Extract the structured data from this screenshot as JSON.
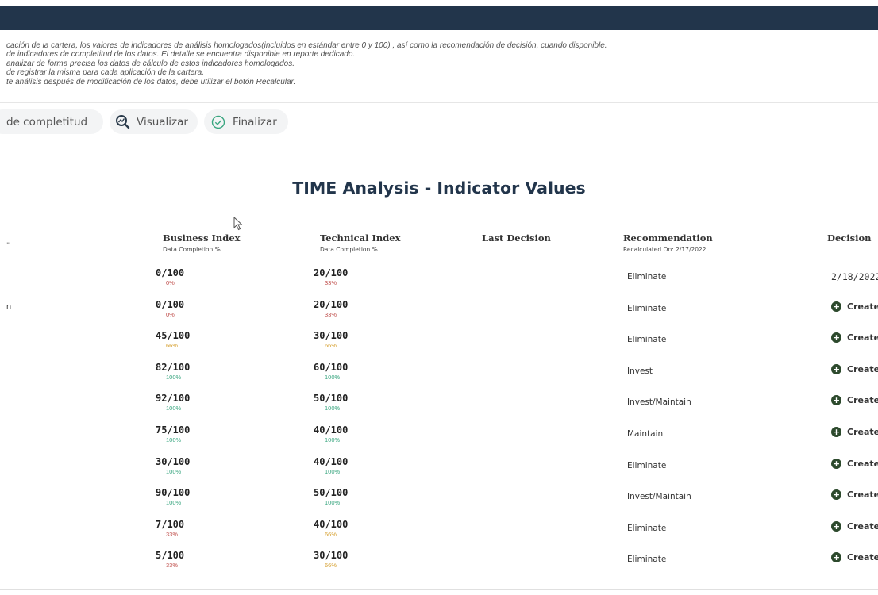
{
  "info_lines": [
    "cación de la cartera, los valores de indicadores de análisis homologados(incluidos en estándar entre 0 y 100) , así como la recomendación de decisión, cuando disponible.",
    "de indicadores de completitud de los datos. El detalle se encuentra disponible en reporte dedicado.",
    "analizar de forma precisa los datos de cálculo de estos indicadores homologados.",
    "de registrar la misma para cada aplicación de la cartera.",
    "te análisis después de modificación de los datos, debe utilizar el botón Recalcular."
  ],
  "toolbar": {
    "completeness_label": "de completitud",
    "visualize_label": "Visualizar",
    "finalize_label": "Finalizar"
  },
  "title": "TIME Analysis - Indicator Values",
  "edge_marks": {
    "header": "\"",
    "row2": "n"
  },
  "columns": {
    "business": {
      "label": "Business Index",
      "sub": "Data Completion %"
    },
    "technical": {
      "label": "Technical Index",
      "sub": "Data Completion %"
    },
    "last_decision": {
      "label": "Last Decision"
    },
    "recommendation": {
      "label": "Recommendation",
      "sub": "Recalculated On: 2/17/2022"
    },
    "decision": {
      "label": "Decision"
    }
  },
  "colors": {
    "low": "#c0504d",
    "mid": "#d6a030",
    "high": "#3aa680"
  },
  "rows": [
    {
      "business": "0/100",
      "business_pct": "0%",
      "business_level": "low",
      "technical": "20/100",
      "technical_pct": "33%",
      "technical_level": "low",
      "recommendation": "Eliminate",
      "decision": "2/18/2022",
      "decision_type": "date"
    },
    {
      "business": "0/100",
      "business_pct": "0%",
      "business_level": "low",
      "technical": "20/100",
      "technical_pct": "33%",
      "technical_level": "low",
      "recommendation": "Eliminate",
      "decision": "Create",
      "decision_type": "create"
    },
    {
      "business": "45/100",
      "business_pct": "66%",
      "business_level": "mid",
      "technical": "30/100",
      "technical_pct": "66%",
      "technical_level": "mid",
      "recommendation": "Eliminate",
      "decision": "Create",
      "decision_type": "create"
    },
    {
      "business": "82/100",
      "business_pct": "100%",
      "business_level": "high",
      "technical": "60/100",
      "technical_pct": "100%",
      "technical_level": "high",
      "recommendation": "Invest",
      "decision": "Create",
      "decision_type": "create"
    },
    {
      "business": "92/100",
      "business_pct": "100%",
      "business_level": "high",
      "technical": "50/100",
      "technical_pct": "100%",
      "technical_level": "high",
      "recommendation": "Invest/Maintain",
      "decision": "Create",
      "decision_type": "create"
    },
    {
      "business": "75/100",
      "business_pct": "100%",
      "business_level": "high",
      "technical": "40/100",
      "technical_pct": "100%",
      "technical_level": "high",
      "recommendation": "Maintain",
      "decision": "Create",
      "decision_type": "create"
    },
    {
      "business": "30/100",
      "business_pct": "100%",
      "business_level": "high",
      "technical": "40/100",
      "technical_pct": "100%",
      "technical_level": "high",
      "recommendation": "Eliminate",
      "decision": "Create",
      "decision_type": "create"
    },
    {
      "business": "90/100",
      "business_pct": "100%",
      "business_level": "high",
      "technical": "50/100",
      "technical_pct": "100%",
      "technical_level": "high",
      "recommendation": "Invest/Maintain",
      "decision": "Create",
      "decision_type": "create"
    },
    {
      "business": "7/100",
      "business_pct": "33%",
      "business_level": "low",
      "technical": "40/100",
      "technical_pct": "66%",
      "technical_level": "mid",
      "recommendation": "Eliminate",
      "decision": "Create",
      "decision_type": "create"
    },
    {
      "business": "5/100",
      "business_pct": "33%",
      "business_level": "low",
      "technical": "30/100",
      "technical_pct": "66%",
      "technical_level": "mid",
      "recommendation": "Eliminate",
      "decision": "Create",
      "decision_type": "create"
    }
  ]
}
